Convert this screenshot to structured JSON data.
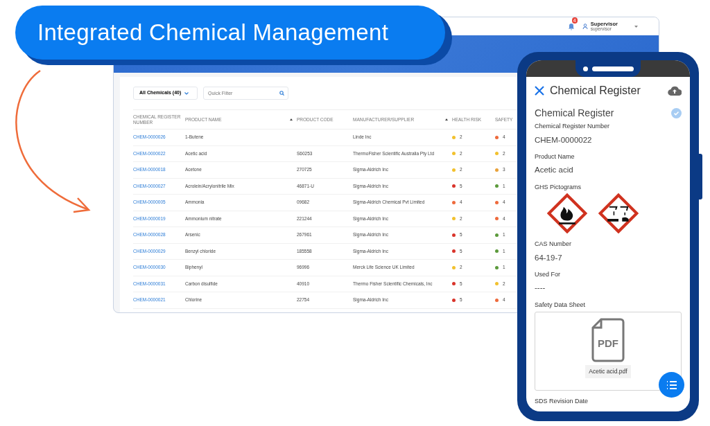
{
  "banner": {
    "title": "Integrated Chemical Management"
  },
  "desktop": {
    "header": {
      "notification_count": "4",
      "user_name": "Supervisor",
      "user_role": "supervisor"
    },
    "toolbar": {
      "view": "All Chemicals (40)",
      "filter_placeholder": "Quick Filter"
    },
    "table": {
      "columns": [
        {
          "label": "CHEMICAL REGISTER NUMBER",
          "sort_arrow": false
        },
        {
          "label": "PRODUCT NAME",
          "sort_arrow": true
        },
        {
          "label": "PRODUCT CODE",
          "sort_arrow": false
        },
        {
          "label": "MANUFACTURER/SUPPLIER",
          "sort_arrow": true
        },
        {
          "label": "HEALTH RISK",
          "sort_arrow": false
        },
        {
          "label": "SAFETY",
          "sort_arrow": false
        }
      ],
      "rows": [
        {
          "number": "CHEM-0000026",
          "product": "1-Butene",
          "manufacturer": "Linde Inc",
          "health": {
            "value": "2",
            "color": "#f2c12e"
          },
          "safety": {
            "value": "4",
            "color": "#ee6a3c"
          }
        },
        {
          "number": "CHEM-0000022",
          "product": "Acetic acid",
          "code": "S60253",
          "manufacturer": "ThermoFisher Scientific Australia Pty Ltd",
          "health": {
            "value": "2",
            "color": "#f2c12e"
          },
          "safety": {
            "value": "2",
            "color": "#f2c12e"
          }
        },
        {
          "number": "CHEM-0000018",
          "product": "Acetone",
          "code": "270725",
          "manufacturer": "Sigma-Aldrich Inc",
          "health": {
            "value": "2",
            "color": "#f2c12e"
          },
          "safety": {
            "value": "3",
            "color": "#e9a23b"
          }
        },
        {
          "number": "CHEM-0000027",
          "product": "Acrolein/Acrylonitrile Mix",
          "code": "46871-U",
          "manufacturer": "Sigma-Aldrich Inc",
          "health": {
            "value": "5",
            "color": "#d9342b"
          },
          "safety": {
            "value": "1",
            "color": "#5c9a3c"
          }
        },
        {
          "number": "CHEM-0000005",
          "product": "Ammonia",
          "code": "09682",
          "manufacturer": "Sigma-Aldrich Chemical Pvt Limited",
          "health": {
            "value": "4",
            "color": "#ee6a3c"
          },
          "safety": {
            "value": "4",
            "color": "#ee6a3c"
          }
        },
        {
          "number": "CHEM-0000019",
          "product": "Ammonium nitrate",
          "code": "221244",
          "manufacturer": "Sigma-Aldrich Inc",
          "health": {
            "value": "2",
            "color": "#f2c12e"
          },
          "safety": {
            "value": "4",
            "color": "#ee6a3c"
          }
        },
        {
          "number": "CHEM-0000028",
          "product": "Arsenic",
          "code": "267961",
          "manufacturer": "Sigma-Aldrich Inc",
          "health": {
            "value": "5",
            "color": "#d9342b"
          },
          "safety": {
            "value": "1",
            "color": "#5c9a3c"
          }
        },
        {
          "number": "CHEM-0000029",
          "product": "Benzyl chloride",
          "code": "185558",
          "manufacturer": "Sigma-Aldrich Inc",
          "health": {
            "value": "5",
            "color": "#d9342b"
          },
          "safety": {
            "value": "1",
            "color": "#5c9a3c"
          }
        },
        {
          "number": "CHEM-0000030",
          "product": "Biphenyl",
          "code": "96996",
          "manufacturer": "Merck Life Science UK Limited",
          "health": {
            "value": "2",
            "color": "#f2c12e"
          },
          "safety": {
            "value": "1",
            "color": "#5c9a3c"
          }
        },
        {
          "number": "CHEM-0000031",
          "product": "Carbon disulfide",
          "code": "40910",
          "manufacturer": "Thermo Fisher Scientific Chemicals, Inc",
          "health": {
            "value": "5",
            "color": "#d9342b"
          },
          "safety": {
            "value": "2",
            "color": "#f2c12e"
          }
        },
        {
          "number": "CHEM-0000021",
          "product": "Chlorine",
          "code": "22754",
          "manufacturer": "Sigma-Aldrich Inc",
          "health": {
            "value": "5",
            "color": "#d9342b"
          },
          "safety": {
            "value": "4",
            "color": "#ee6a3c"
          }
        }
      ]
    }
  },
  "phone": {
    "title": "Chemical Register",
    "section": "Chemical Register",
    "verified": true,
    "fields": [
      {
        "kind": "text",
        "label": "Chemical Register Number",
        "value": "CHEM-0000022"
      },
      {
        "kind": "text",
        "label": "Product Name",
        "value": "Acetic acid"
      },
      {
        "kind": "pictograms",
        "label": "GHS Pictograms",
        "pictograms": [
          {
            "kind": "flame"
          },
          {
            "kind": "corrosion"
          }
        ]
      },
      {
        "kind": "text",
        "label": "CAS Number",
        "value": "64-19-7"
      },
      {
        "kind": "text",
        "label": "Used For",
        "value": "----"
      },
      {
        "kind": "file",
        "label": "Safety Data Sheet",
        "file_type": "PDF",
        "file_name": "Acetic acid.pdf"
      },
      {
        "kind": "label",
        "label": "SDS Revision Date"
      }
    ]
  }
}
